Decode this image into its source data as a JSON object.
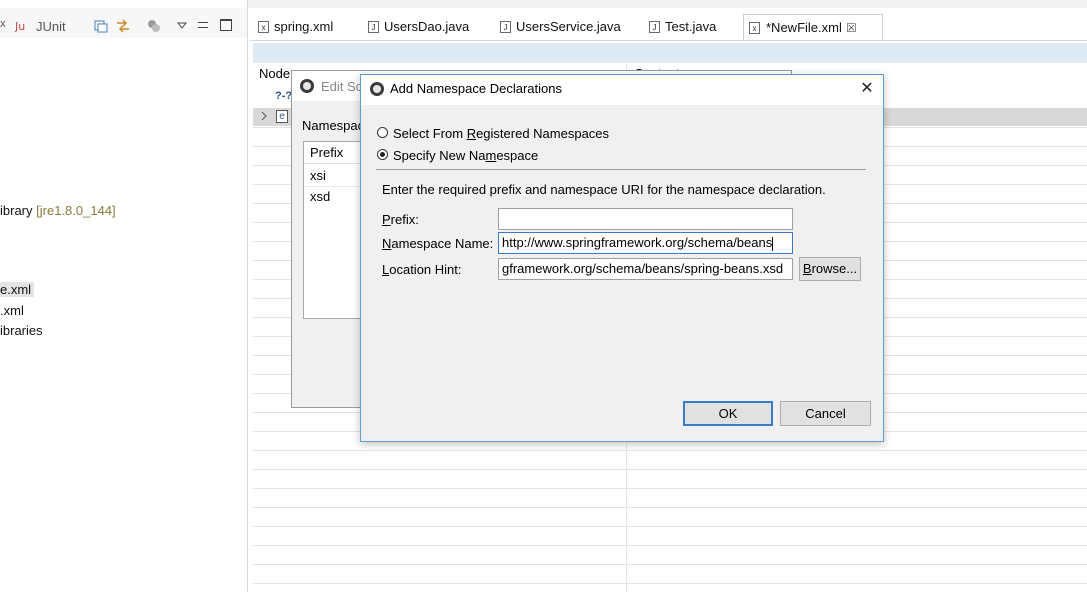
{
  "left_panel": {
    "junit_tab": "JUnit",
    "tree": [
      {
        "main": "ibrary",
        "dim": "[jre1.8.0_144]"
      },
      {
        "main": "e.xml"
      },
      {
        "main": ".xml"
      },
      {
        "main": "ibraries"
      }
    ]
  },
  "tabs": [
    {
      "label": "spring.xml",
      "icon": "xml-file-icon"
    },
    {
      "label": "UsersDao.java",
      "icon": "java-file-icon"
    },
    {
      "label": "UsersService.java",
      "icon": "java-file-icon"
    },
    {
      "label": "Test.java",
      "icon": "java-file-icon"
    },
    {
      "label": "*NewFile.xml",
      "icon": "xml-file-icon",
      "active": true
    }
  ],
  "editor": {
    "node_header": "Node",
    "content_header": "Content",
    "row_prefix": "?-?",
    "element_badge": "e"
  },
  "bg_dialog": {
    "title": "Edit Sc",
    "namespace_label": "Namespac",
    "list_header": "Prefix",
    "list_items": [
      "xsi",
      "xsd"
    ]
  },
  "dialog": {
    "title": "Add Namespace Declarations",
    "radio_registered": {
      "before": "Select From ",
      "accel": "R",
      "after": "egistered Namespaces"
    },
    "radio_new": {
      "before": "Specify New Na",
      "accel": "m",
      "after": "espace"
    },
    "instruction": "Enter the required prefix and namespace URI for the namespace declaration.",
    "prefix_label": {
      "accel": "P",
      "after": "refix:"
    },
    "prefix_value": "",
    "namespace_label": {
      "accel": "N",
      "after": "amespace Name:"
    },
    "namespace_value": "http://www.springframework.org/schema/beans",
    "location_label": {
      "accel": "L",
      "after": "ocation Hint:"
    },
    "location_value": "gframework.org/schema/beans/spring-beans.xsd",
    "browse_label": {
      "before": "",
      "accel": "B",
      "after": "rowse..."
    },
    "ok_label": "OK",
    "cancel_label": "Cancel"
  }
}
